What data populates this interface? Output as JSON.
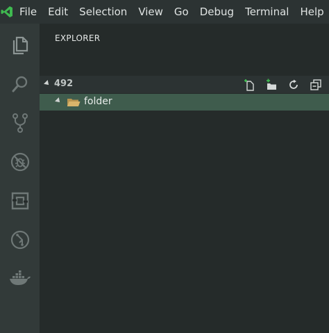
{
  "menu": [
    "File",
    "Edit",
    "Selection",
    "View",
    "Go",
    "Debug",
    "Terminal",
    "Help"
  ],
  "activity_bar": [
    {
      "name": "explorer",
      "icon": "files-icon"
    },
    {
      "name": "search",
      "icon": "search-icon"
    },
    {
      "name": "source-control",
      "icon": "source-control-icon"
    },
    {
      "name": "debug",
      "icon": "no-bug-icon"
    },
    {
      "name": "extensions",
      "icon": "extensions-icon"
    },
    {
      "name": "git-lens",
      "icon": "git-history-icon"
    },
    {
      "name": "docker",
      "icon": "docker-icon"
    }
  ],
  "sidebar": {
    "title": "EXPLORER",
    "section": {
      "label": "492",
      "actions": [
        "new-file-icon",
        "new-folder-icon",
        "refresh-icon",
        "collapse-all-icon"
      ]
    },
    "tree": [
      {
        "label": "folder",
        "expanded": true,
        "selected": true
      }
    ]
  },
  "colors": {
    "accent_green": "#3fb950",
    "selection_bg": "#3f5c4d",
    "folder": "#d9b56b"
  }
}
